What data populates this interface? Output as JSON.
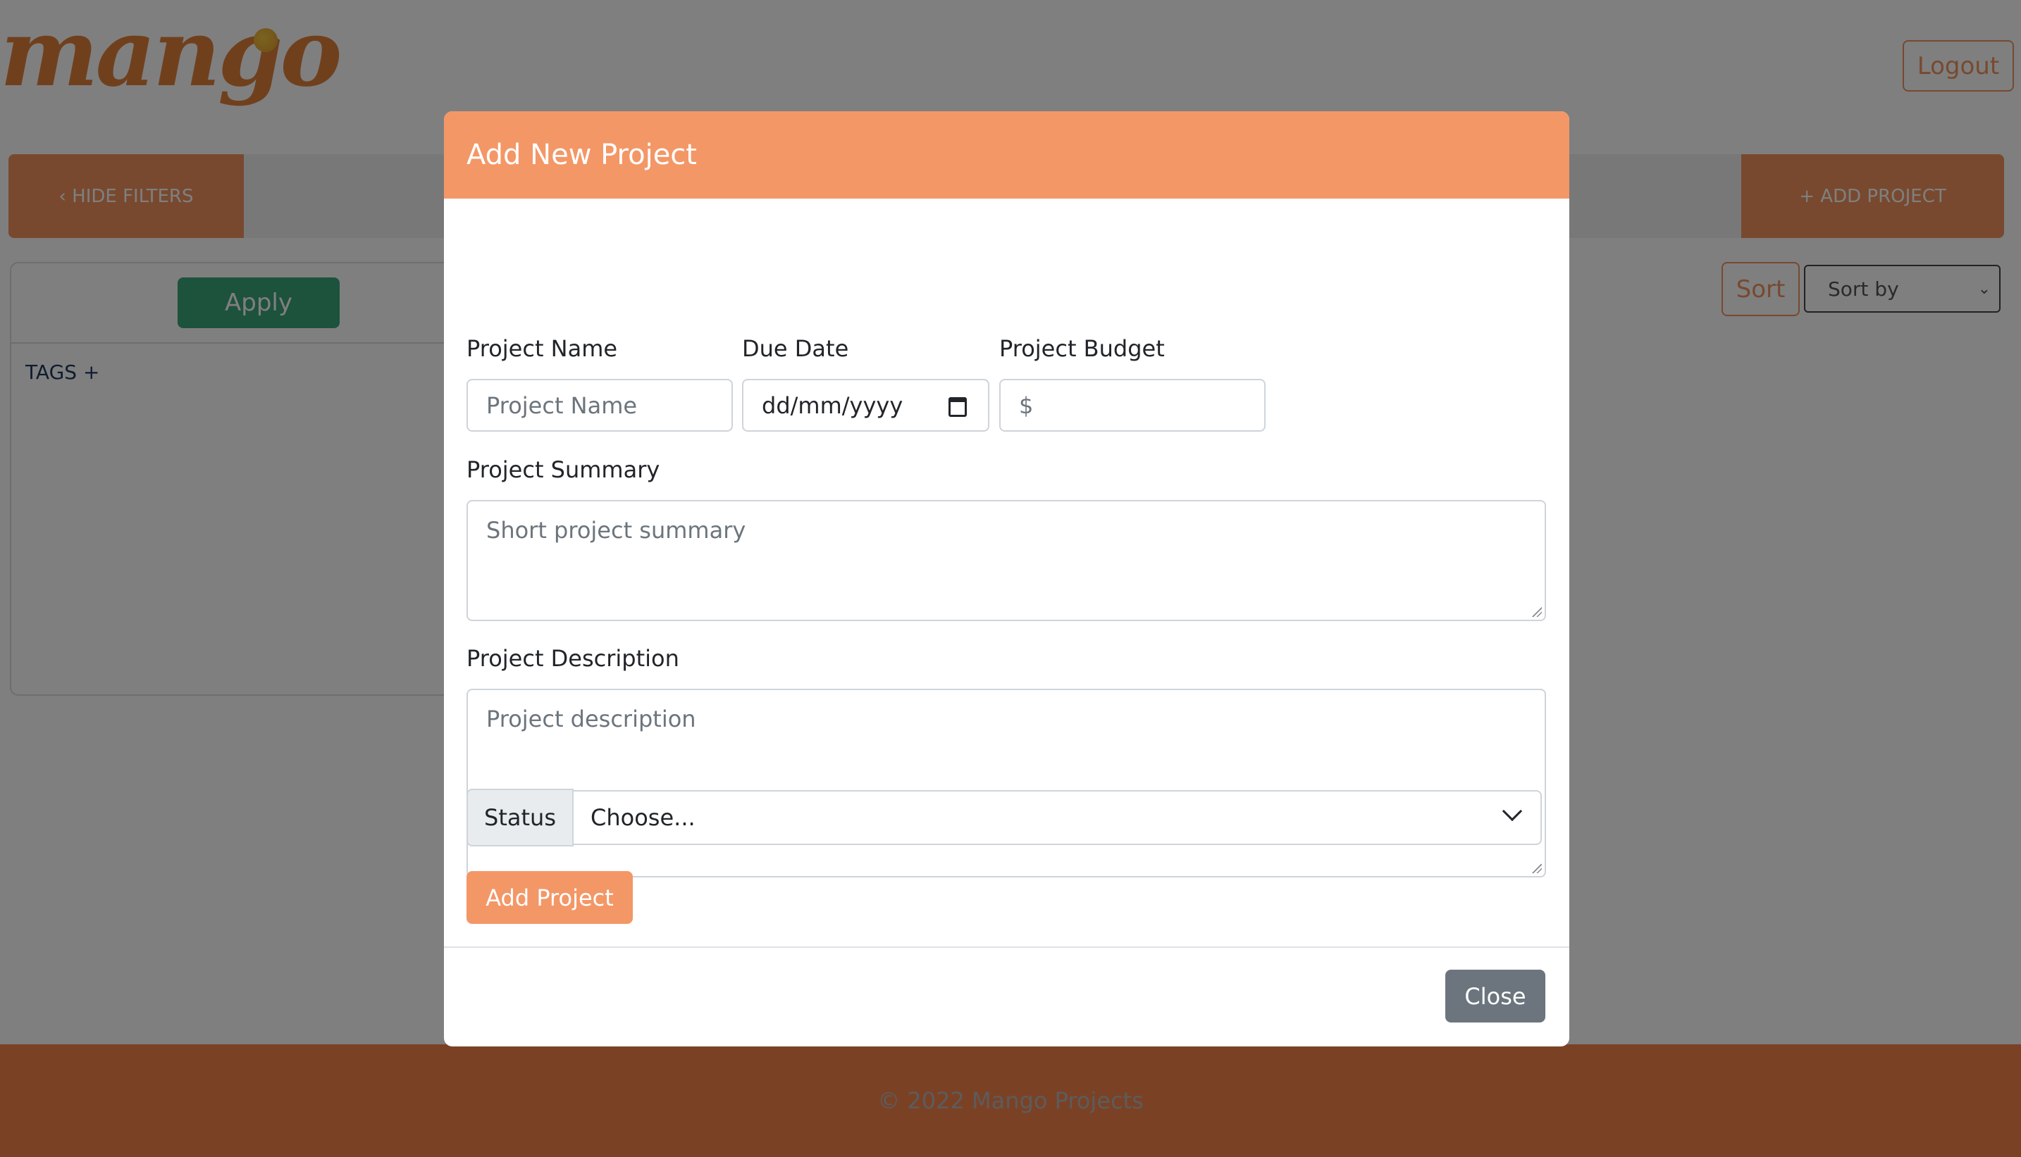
{
  "brand": {
    "logo_text": "mango"
  },
  "header": {
    "logout_label": "Logout"
  },
  "toolbar": {
    "hide_filters_label": "‹ HIDE FILTERS",
    "add_project_label": "+ ADD PROJECT"
  },
  "filters": {
    "apply_label": "Apply",
    "tags_label": "TAGS +"
  },
  "sorting": {
    "sort_label": "Sort",
    "sort_by_value": "Sort by"
  },
  "footer": {
    "copyright": "© 2022 Mango Projects"
  },
  "modal": {
    "title": "Add New Project",
    "fields": {
      "project_name": {
        "label": "Project Name",
        "placeholder": "Project Name"
      },
      "due_date": {
        "label": "Due Date",
        "value": "dd/mm/yyyy"
      },
      "project_budget": {
        "label": "Project Budget",
        "placeholder": "$"
      },
      "project_summary": {
        "label": "Project Summary",
        "placeholder": "Short project summary"
      },
      "project_description": {
        "label": "Project Description",
        "placeholder": "Project description"
      },
      "status": {
        "label": "Status",
        "value": "Choose..."
      }
    },
    "submit_label": "Add Project",
    "close_label": "Close"
  },
  "colors": {
    "accent": "#f39767",
    "apply_green": "#3aa57a",
    "close_grey": "#6c757d",
    "footer": "#f7824a"
  }
}
